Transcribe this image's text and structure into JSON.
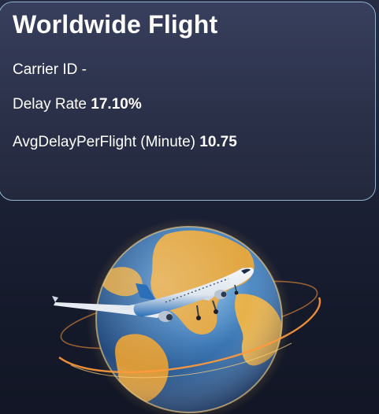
{
  "card": {
    "title": "Worldwide Flight",
    "metrics": [
      {
        "label": "Carrier ID -",
        "value": ""
      },
      {
        "label": "Delay Rate",
        "value": "17.10%"
      },
      {
        "label": "AvgDelayPerFlight (Minute)",
        "value": "10.75"
      }
    ]
  },
  "hero": {
    "icon": "globe-airplane-illustration",
    "colors": {
      "ocean": "#3a76b4",
      "land": "#e2a640",
      "glow": "#f0c060",
      "orbit": "#ff9a3c"
    }
  },
  "theme": {
    "background": "#1d2238",
    "card_background": "#2f3550",
    "card_border": "#8fb5cf",
    "text": "#ffffff"
  }
}
